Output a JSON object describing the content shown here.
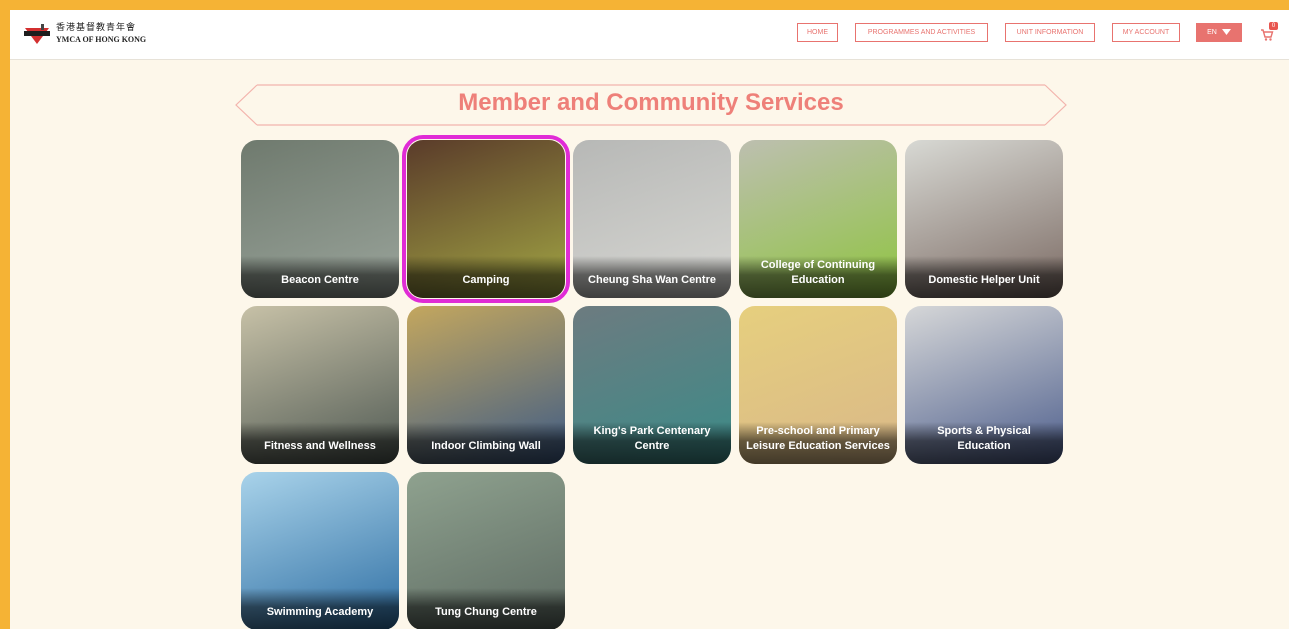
{
  "header": {
    "logo_cn": "香港基督教青年會",
    "logo_en": "YMCA OF HONG KONG",
    "nav": [
      {
        "label": "HOME"
      },
      {
        "label": "PROGRAMMES AND ACTIVITIES"
      },
      {
        "label": "UNIT INFORMATION"
      },
      {
        "label": "MY ACCOUNT"
      }
    ],
    "language": "EN",
    "cart_count": "0"
  },
  "main": {
    "title": "Member and Community Services",
    "tiles": [
      {
        "label": "Beacon Centre",
        "colors": [
          "#6f7a6e",
          "#9aa49b"
        ]
      },
      {
        "label": "Camping",
        "colors": [
          "#5a3b2a",
          "#a2a644"
        ],
        "selected": true
      },
      {
        "label": "Cheung Sha Wan Centre",
        "colors": [
          "#b7b8b6",
          "#d7d7d3"
        ]
      },
      {
        "label": "College of Continuing Education",
        "colors": [
          "#bdbfb0",
          "#8fc440"
        ]
      },
      {
        "label": "Domestic Helper Unit",
        "colors": [
          "#d8d9d4",
          "#7b6a63"
        ]
      },
      {
        "label": "Fitness and Wellness",
        "colors": [
          "#c7c1a7",
          "#4f5953"
        ]
      },
      {
        "label": "Indoor Climbing Wall",
        "colors": [
          "#c4a75e",
          "#3d5b86"
        ]
      },
      {
        "label": "King's Park Centenary Centre",
        "colors": [
          "#6d7b80",
          "#3b8b88"
        ]
      },
      {
        "label": "Pre-school and Primary Leisure Education Services",
        "colors": [
          "#e6cf7e",
          "#d9b888"
        ]
      },
      {
        "label": "Sports & Physical Education",
        "colors": [
          "#d6d7d8",
          "#4e5f8d"
        ]
      },
      {
        "label": "Swimming Academy",
        "colors": [
          "#a9d3ea",
          "#2e6ea3"
        ]
      },
      {
        "label": "Tung Chung Centre",
        "colors": [
          "#8fa28f",
          "#5d6a62"
        ]
      }
    ]
  },
  "colors": {
    "accent": "#e8736f",
    "title": "#ee8079",
    "selected_outline": "#e02bd6",
    "frame": "#f5b335",
    "page_bg": "#fdf7ea"
  }
}
